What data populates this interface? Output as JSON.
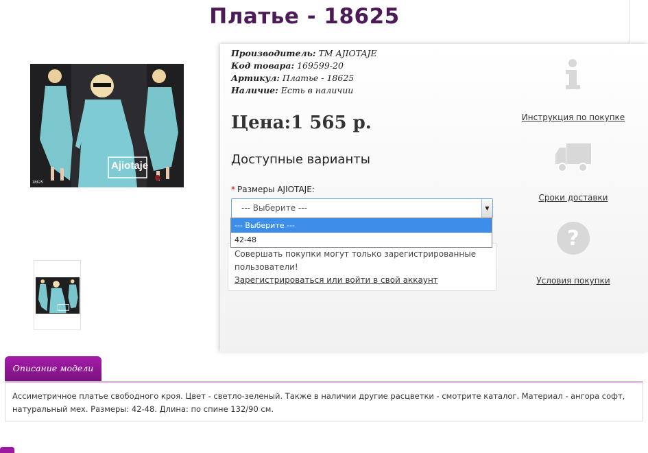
{
  "product": {
    "title": "Платье - 18625",
    "meta": [
      {
        "key": "Производитель:",
        "value": "TM AJIOTAJE"
      },
      {
        "key": "Код товара:",
        "value": "169599-20"
      },
      {
        "key": "Артикул:",
        "value": "Платье - 18625"
      },
      {
        "key": "Наличие:",
        "value": "Есть в наличии"
      }
    ],
    "price": "Цена:1 565 р.",
    "photo_brand": "Ajiotaje",
    "photo_code": "18625"
  },
  "options": {
    "heading": "Доступные варианты",
    "size_label": "Размеры AJIOTAJE:",
    "required_mark": "*",
    "selected": "--- Выберите ---",
    "list": [
      "--- Выберите ---",
      "42-48"
    ]
  },
  "notice": {
    "text": "Совершать покупки могут только зарегистрированные пользователи!",
    "link": "Зарегистрироваться или войти в свой аккаунт"
  },
  "side": {
    "instruction": "Инструкция по покупке",
    "delivery": "Сроки доставки",
    "terms": "Условия покупки"
  },
  "description": {
    "tab": "Описание модели",
    "text": "Ассиметричное платье свободного кроя. Цвет - светло-зеленый. Также в наличии другие расцветки - смотрите каталог. Материал - ангора софт, натуральный мех. Размеры: 42-48. Длина: по спине 132/90 см."
  },
  "colors": {
    "title": "#4b1a57",
    "accent": "#a51ca8",
    "dress": "#79c8cf",
    "icon_gray": "#d8d8d8"
  }
}
